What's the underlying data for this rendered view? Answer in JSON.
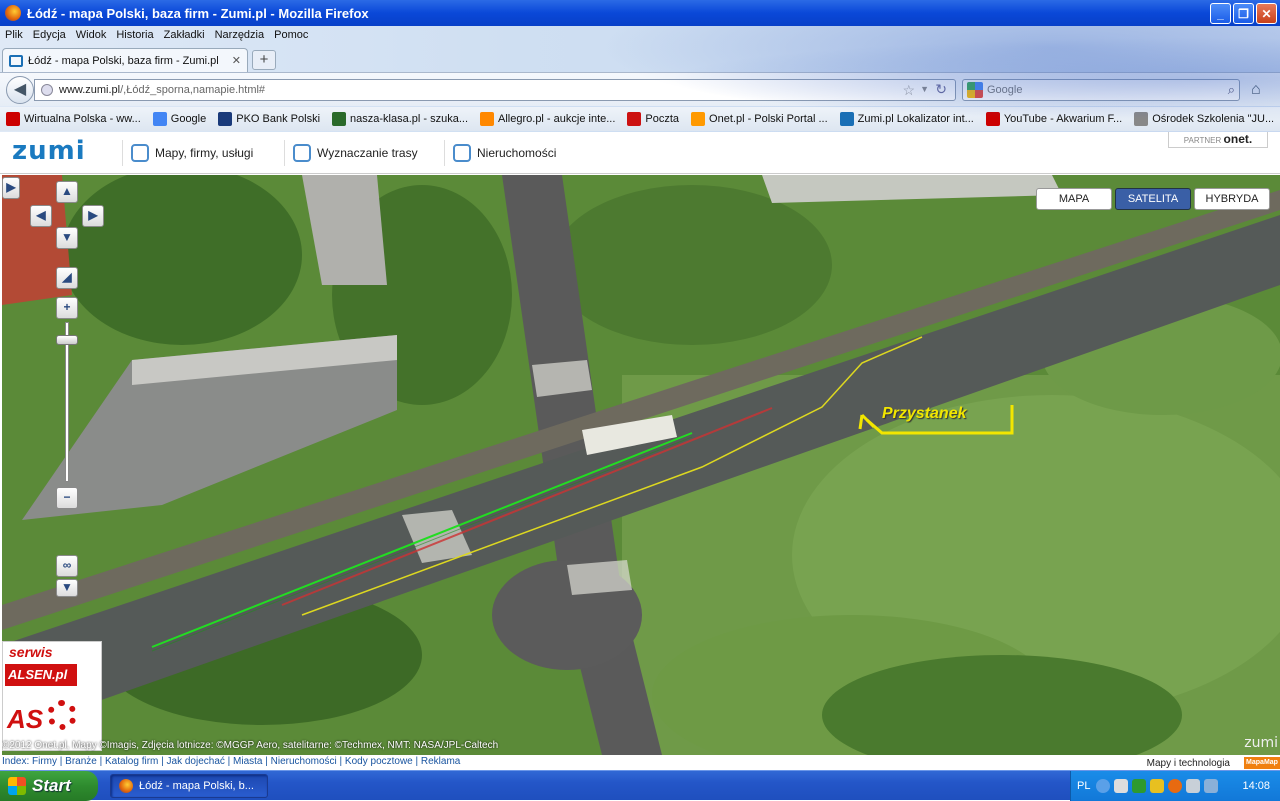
{
  "window": {
    "title": "Łódź - mapa Polski, baza firm - Zumi.pl - Mozilla Firefox"
  },
  "menu": [
    "Plik",
    "Edycja",
    "Widok",
    "Historia",
    "Zakładki",
    "Narzędzia",
    "Pomoc"
  ],
  "tab": {
    "label": "Łódź - mapa Polski, baza firm - Zumi.pl",
    "new_tab": "+"
  },
  "url": {
    "host": "www.zumi.pl",
    "path": "/,Łódź_sporna,namapie.html#"
  },
  "search": {
    "placeholder": "Google"
  },
  "bookmarks": [
    {
      "label": "Wirtualna Polska - ww...",
      "color": "#cc0000"
    },
    {
      "label": "Google",
      "color": "#4285f4"
    },
    {
      "label": "PKO Bank Polski",
      "color": "#1a3a7a"
    },
    {
      "label": "nasza-klasa.pl - szuka...",
      "color": "#2a6a2a"
    },
    {
      "label": "Allegro.pl - aukcje inte...",
      "color": "#ff8800"
    },
    {
      "label": "Poczta",
      "color": "#cc1111"
    },
    {
      "label": "Onet.pl - Polski Portal ...",
      "color": "#ff9900"
    },
    {
      "label": "Zumi.pl Lokalizator int...",
      "color": "#1a6fb5"
    },
    {
      "label": "YouTube - Akwarium F...",
      "color": "#cc0000"
    },
    {
      "label": "Ośrodek Szkolenia \"JU...",
      "color": "#888888"
    }
  ],
  "zumi": {
    "logo": "ZUMI",
    "nav": [
      "Mapy, firmy, usługi",
      "Wyznaczanie trasy",
      "Nieruchomości"
    ],
    "partner_prefix": "PARTNER",
    "partner_name": "onet."
  },
  "map": {
    "modes": [
      "MAPA",
      "SATELITA",
      "HYBRYDA"
    ],
    "active_mode": "SATELITA",
    "label": "Przystanek",
    "watermark": "ZUMI",
    "copyright": "©2012 Onet.pl, Mapy ©Imagis, Zdjęcia lotnicze: ©MGGP Aero, satelitarne: ©Techmex, NMT: NASA/JPL-Caltech",
    "advert": {
      "line1": "serwis",
      "line2": "ALSEN.pl",
      "line3": "AS"
    }
  },
  "footer": {
    "links": "Index: Firmy | Branże | Katalog firm | Jak dojechać | Miasta | Nieruchomości | Kody pocztowe | Reklama",
    "tech": "Mapy i technologia",
    "brand": "MapaMap"
  },
  "taskbar": {
    "start": "Start",
    "task": "Łódź - mapa Polski, b...",
    "lang": "PL",
    "clock": "14:08"
  }
}
